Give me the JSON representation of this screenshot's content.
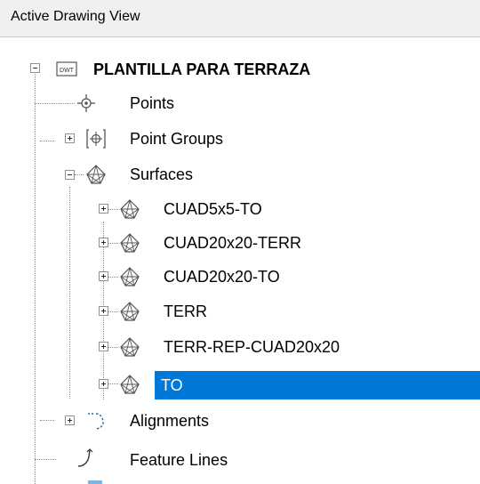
{
  "panel": {
    "title": "Active Drawing View"
  },
  "tree": {
    "root": {
      "label": "PLANTILLA PARA TERRAZA",
      "icon": "dwt-file-icon"
    },
    "points": {
      "label": "Points",
      "icon": "points-icon"
    },
    "point_groups": {
      "label": "Point Groups",
      "icon": "point-groups-icon"
    },
    "surfaces": {
      "label": "Surfaces",
      "icon": "surface-icon",
      "items": [
        {
          "label": "CUAD5x5-TO"
        },
        {
          "label": "CUAD20x20-TERR"
        },
        {
          "label": "CUAD20x20-TO"
        },
        {
          "label": "TERR"
        },
        {
          "label": "TERR-REP-CUAD20x20"
        },
        {
          "label": "TO"
        }
      ],
      "selected": "TO"
    },
    "alignments": {
      "label": "Alignments",
      "icon": "alignment-icon"
    },
    "feature_lines": {
      "label": "Feature Lines",
      "icon": "feature-line-icon"
    }
  },
  "colors": {
    "selection": "#0078d7",
    "header_bg": "#f0f0f0"
  }
}
